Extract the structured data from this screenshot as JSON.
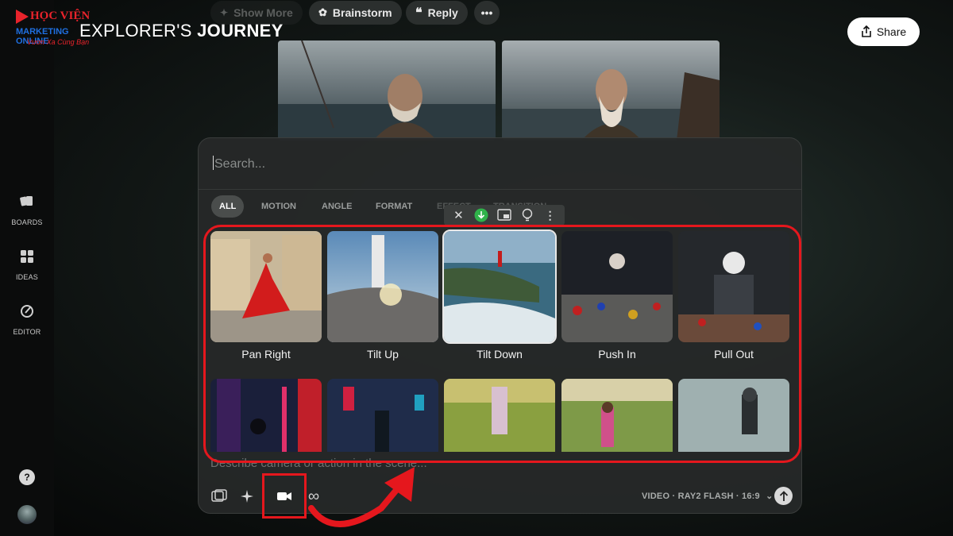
{
  "brand": {
    "line1": "HỌC VIỆN",
    "line2": "MARKETING ONLINE",
    "line3": "Vươn Xa Cùng Bạn"
  },
  "project": {
    "title_light": "EXPLORER'S",
    "title_bold": "JOURNEY"
  },
  "top_actions": {
    "show_more": "Show More",
    "brainstorm": "Brainstorm",
    "reply": "Reply"
  },
  "share_label": "Share",
  "sidebar": {
    "boards": "BOARDS",
    "ideas": "IDEAS",
    "editor": "EDITOR",
    "help": "?"
  },
  "search": {
    "placeholder": "Search..."
  },
  "filters": [
    "ALL",
    "MOTION",
    "ANGLE",
    "FORMAT",
    "EFFECT",
    "TRANSITION"
  ],
  "presets": [
    "Pan Right",
    "Tilt Up",
    "Tilt Down",
    "Push In",
    "Pull Out"
  ],
  "prompt": {
    "placeholder": "Describe camera or action in the scene..."
  },
  "model_label": "VIDEO · RAY2 FLASH · 16:9",
  "colors": {
    "accent_red": "#e5171d",
    "panel": "#262828",
    "download_green": "#2fb34a"
  }
}
